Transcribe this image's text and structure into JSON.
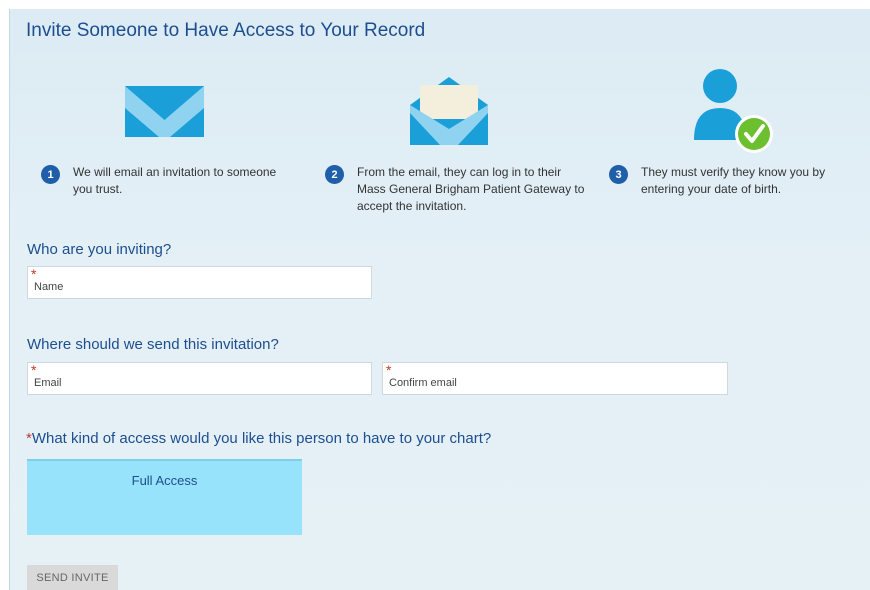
{
  "page": {
    "title": "Invite Someone to Have Access to Your Record"
  },
  "steps": [
    {
      "number": "1",
      "icon": "envelope-icon",
      "text": "We will email an invitation to someone you trust."
    },
    {
      "number": "2",
      "icon": "open-envelope-icon",
      "text": "From the email, they can log in to their Mass General Brigham Patient Gateway to accept the invitation."
    },
    {
      "number": "3",
      "icon": "verified-user-icon",
      "text": "They must verify they know you by entering your date of birth."
    }
  ],
  "who": {
    "heading": "Who are you inviting?",
    "name_placeholder": "Name",
    "required_mark": "*"
  },
  "where": {
    "heading": "Where should we send this invitation?",
    "email_placeholder": "Email",
    "confirm_placeholder": "Confirm email",
    "required_mark": "*"
  },
  "access": {
    "required_mark": "*",
    "heading": "What kind of access would you like this person to have to your chart?",
    "option_label": "Full Access"
  },
  "actions": {
    "send_label": "SEND INVITE"
  },
  "colors": {
    "accent": "#1d4e8f",
    "icon_blue": "#1a9fd8",
    "icon_light": "#8fd3f1",
    "check_green": "#6cbf2e",
    "access_tile": "#97e3fb"
  }
}
